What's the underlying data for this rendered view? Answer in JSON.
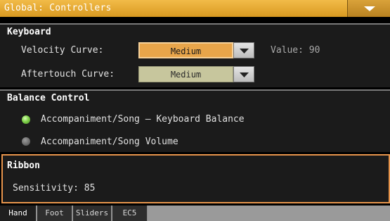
{
  "window": {
    "title": "Global: Controllers"
  },
  "keyboard": {
    "heading": "Keyboard",
    "velocity_curve": {
      "label": "Velocity Curve:",
      "value": "Medium",
      "value_readout": "Value: 90"
    },
    "aftertouch_curve": {
      "label": "Aftertouch Curve:",
      "value": "Medium"
    }
  },
  "balance_control": {
    "heading": "Balance Control",
    "options": [
      {
        "label": "Accompaniment/Song – Keyboard Balance",
        "selected": true
      },
      {
        "label": "Accompaniment/Song Volume",
        "selected": false
      }
    ]
  },
  "ribbon": {
    "heading": "Ribbon",
    "sensitivity": "Sensitivity: 85"
  },
  "tabs": [
    {
      "label": "Hand",
      "active": true
    },
    {
      "label": "Foot",
      "active": false
    },
    {
      "label": "Sliders",
      "active": false
    },
    {
      "label": "EC5",
      "active": false
    }
  ],
  "icons": {
    "title_menu": "chevron-down-icon",
    "dropdown": "triangle-down-icon",
    "radio": "radio-button-icon"
  },
  "colors": {
    "title_bar": "#e6aa35",
    "selected_dropdown": "#e8a54a",
    "ribbon_highlight": "#e8954c",
    "radio_on": "#7fd14a",
    "radio_off": "#6e6e6e"
  }
}
